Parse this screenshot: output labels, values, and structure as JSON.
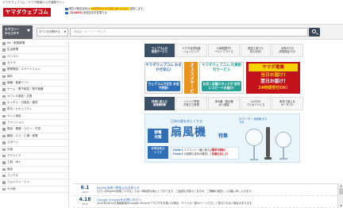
{
  "top": {
    "site_name": "ヤマダウェブコム",
    "separator": "|",
    "tagline": "ヤマダ電機の公式通販サイト"
  },
  "header": {
    "logo_text": "ヤマダウェブコム",
    "delivery_line1_pre": "現在の配送目安は",
    "delivery_line1_hl": "ヤマダランドとおしせーション",
    "delivery_line1_post": "連携します。",
    "delivery_line2_pre": "",
    "delivery_line2_num": "2220001",
    "delivery_line2_post": "配送目安を変更する"
  },
  "search": {
    "category_button_line1": "カテゴリー",
    "category_button_line2": "からさがす",
    "category_button_arrow": "▼",
    "scope_label": "すべての分野から",
    "scope_arrow": "▼",
    "input_placeholder": "商品名・キーワードを入力"
  },
  "sidebar": {
    "items": [
      {
        "label": "AV・家庭劇場"
      },
      {
        "label": "生活家電"
      },
      {
        "label": "パソコン"
      },
      {
        "label": "カメラ"
      },
      {
        "label": "携帯電話・スマートフォン"
      },
      {
        "label": "時計"
      },
      {
        "label": "楽器・音楽ソフト"
      },
      {
        "label": "ゲーム・電子辞書・電子楽器"
      },
      {
        "label": "オフィス用品・文具"
      },
      {
        "label": "キッチン・日用品・雑貨"
      },
      {
        "label": "防災・セキュリティ"
      },
      {
        "label": "ペット用品"
      },
      {
        "label": "ファッション"
      },
      {
        "label": "美容・健康・ベビー・子供"
      },
      {
        "label": "趣味・エコ・工場・家電"
      },
      {
        "label": "スポーツ"
      },
      {
        "label": "お酒"
      },
      {
        "label": "アウトドア"
      },
      {
        "label": "工具・DIY"
      },
      {
        "label": "食品"
      },
      {
        "label": "ブックス"
      },
      {
        "label": "ジョンソン・トイ"
      },
      {
        "label": "その他"
      }
    ]
  },
  "tabs_row1": [
    {
      "line1": "ウェブコムの",
      "line2": "配送サービス",
      "active": true
    },
    {
      "line1": "ヤマダ会員特典",
      "line2": "ショッピング",
      "active": false
    },
    {
      "line1": "24時間受付!",
      "line2": "ベストプライス",
      "active": false
    },
    {
      "line1": "配送工事でも",
      "line2": "安心対応!",
      "active": false
    },
    {
      "line1": "出荷が1日!",
      "line2": "延長保証つき!",
      "active": false
    }
  ],
  "promos": {
    "a_top": "ヤマダウェブコム おまかせ安心!",
    "a_bottom": "ウェブコムで注文 お店で受取!",
    "osusume": "オススメサービス",
    "b_top": "ヤマダウェブコム 社員割引サービス",
    "b_bottom": "お近く店舗スタッフが 自宅にスピードお届け!",
    "c_l1": "ヤマダ電機",
    "c_l2": "当日お届け!",
    "c_l3": "翌日お届け!",
    "c_l4": "24時間受付OK!"
  },
  "tabs_row2": [
    {
      "line1": "快適に使える",
      "line2": "扇風機特集",
      "active": true
    },
    {
      "line1": "ジメジメ季節",
      "line2": "お役立ち家電",
      "active": false
    },
    {
      "line1": "浄水器・整水器",
      "line2": "水と健康",
      "active": false
    },
    {
      "line1": "父の日の",
      "line2": "プレゼントにも",
      "active": false
    },
    {
      "line1": "家具で揃える",
      "line2": "ポータブル",
      "active": false
    }
  ],
  "fan_banner": {
    "sub": "日本の夏を涼しくする",
    "title": "扇風機",
    "tokushu": "特集",
    "tag_line1": "節電",
    "tag_line2": "対策",
    "dc_label": "DCモーター 扇風機 おすすめ",
    "tag2_line1": "家電量販店",
    "tag2_line2": "ヤマダ",
    "point1_label": "Point.1",
    "point1_text": "エアコンと一緒に使えば",
    "point1_red": "電気代節約!",
    "point2_label": "Point.2",
    "point2_text": "お部屋の空気が循環して",
    "point2_red": "快適な涼しさ!"
  },
  "news": [
    {
      "md": "6.1",
      "yr": "2015",
      "title": "PayPal決済一時休止のお知らせ",
      "body": "ただいまPayPal決済につきましては一時利用を休止しております。ご迷惑をお掛けしますが、ご理解の程宜しくお願い申し上げます。"
    },
    {
      "md": "4.18",
      "yr": "2015",
      "title": "Google Chromeをお使いの方へ",
      "body": "2015年4月14日頃最新版のGoogle Chromeブラウザをお使いの場合、サイトの一部のページで正しく表示されない場合があります。"
    }
  ],
  "colors": {
    "brand_red": "#c4121d",
    "brand_yellow": "#f6d200",
    "nav_dark": "#3b4f66",
    "link_blue": "#2e6eb5",
    "promo_blue": "#2e6eb5",
    "promo_orange": "#e8931d",
    "promo_teal": "#2aa198"
  }
}
